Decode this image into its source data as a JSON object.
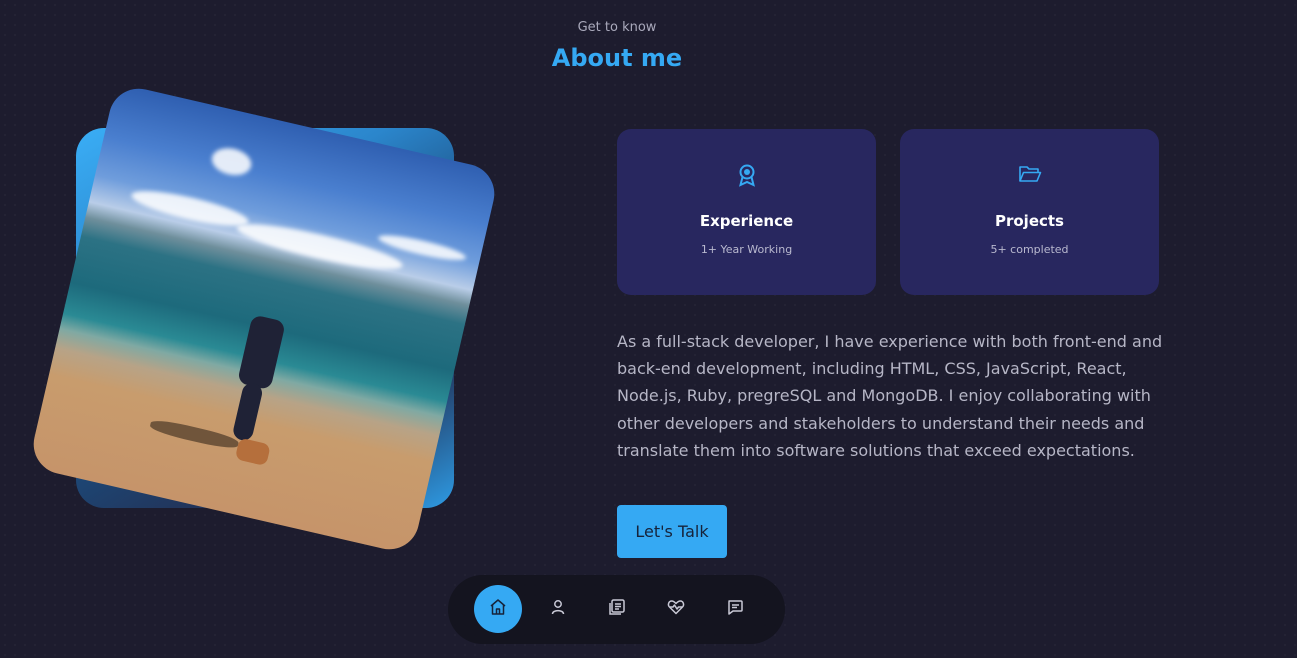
{
  "header": {
    "subtitle": "Get to know",
    "title": "About me"
  },
  "photo": {
    "description_icon": "profile-photo"
  },
  "cards": [
    {
      "icon": "award-icon",
      "title": "Experience",
      "subtitle": "1+ Year Working"
    },
    {
      "icon": "folder-icon",
      "title": "Projects",
      "subtitle": "5+ completed"
    }
  ],
  "about": {
    "text": "As a full-stack developer, I have experience with both front-end and back-end development, including HTML, CSS, JavaScript, React, Node.js, Ruby, pregreSQL and MongoDB. I enjoy collaborating with other developers and stakeholders to understand their needs and translate them into software solutions that exceed expectations.",
    "button_label": "Let's Talk"
  },
  "nav": {
    "items": [
      "home-icon",
      "user-icon",
      "book-icon",
      "services-icon",
      "message-icon"
    ],
    "active_index": 0
  },
  "colors": {
    "accent": "#35a9f3",
    "background": "#1d1c2e",
    "card": "#28275f",
    "nav_background": "#14141f"
  }
}
